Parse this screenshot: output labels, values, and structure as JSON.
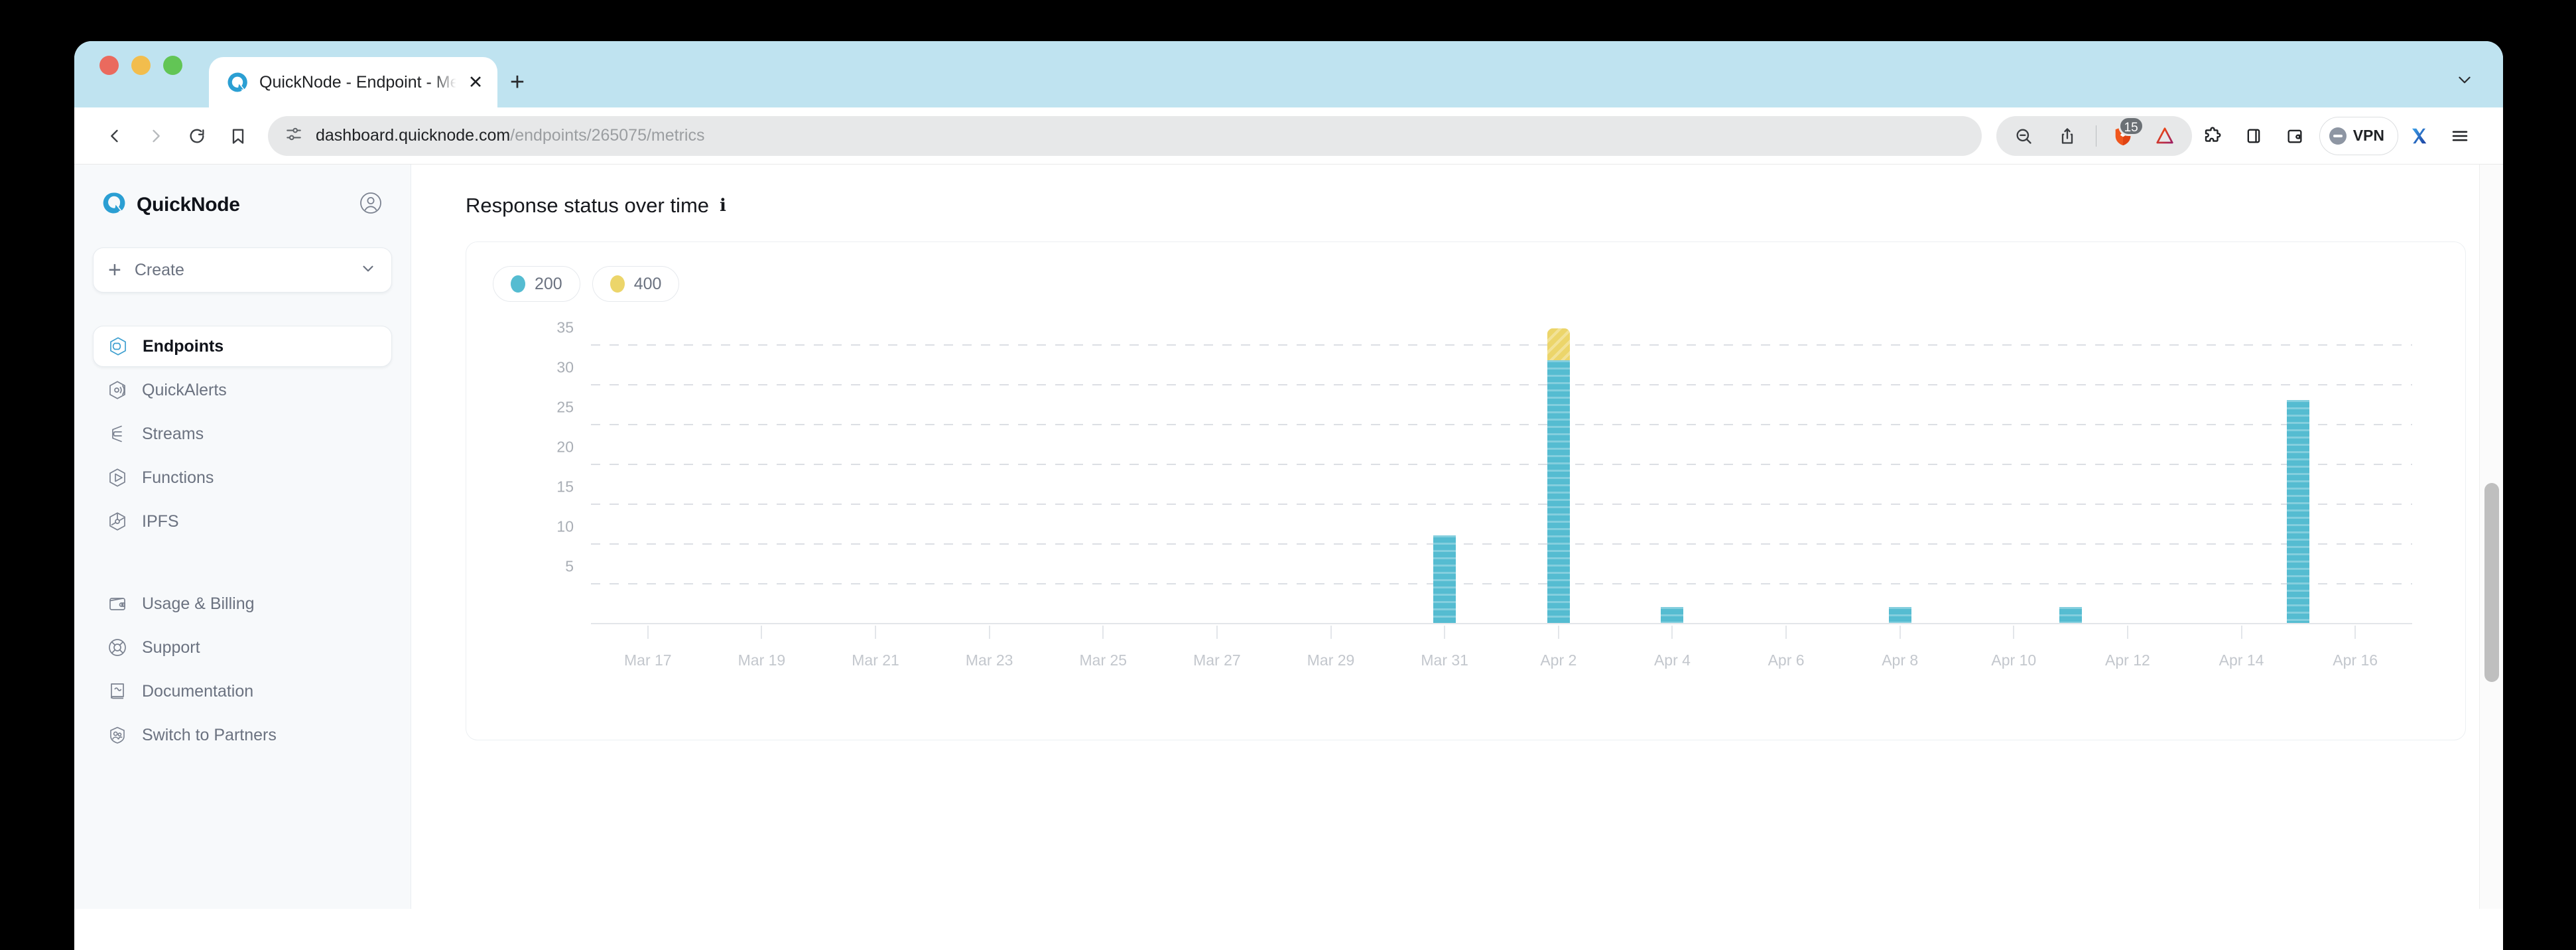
{
  "browser": {
    "tab": {
      "title": "QuickNode - Endpoint - Metrics",
      "favicon_icon": "quicknode-logo-icon",
      "close_icon": "close-icon"
    },
    "new_tab_icon": "plus-icon",
    "tab_list_icon": "chevron-down-icon",
    "nav": {
      "back_icon": "back-arrow-icon",
      "forward_icon": "forward-arrow-icon",
      "reload_icon": "reload-icon",
      "bookmark_icon": "bookmark-icon"
    },
    "omnibox": {
      "site_settings_icon": "tune-sliders-icon",
      "domain": "dashboard.quicknode.com",
      "path": "/endpoints/265075/metrics"
    },
    "actions": [
      {
        "name": "zoom-out-icon",
        "label": ""
      },
      {
        "name": "share-icon",
        "label": ""
      },
      {
        "name": "brave-shield-icon",
        "label": "",
        "badge": "15"
      },
      {
        "name": "brave-rewards-icon",
        "label": ""
      },
      {
        "name": "extensions-icon",
        "label": ""
      },
      {
        "name": "sidebar-panel-icon",
        "label": ""
      },
      {
        "name": "wallet-icon",
        "label": ""
      }
    ],
    "vpn": {
      "label": "VPN",
      "icon": "vpn-toggle-icon"
    },
    "profile_icon": "x-profile-icon",
    "menu_icon": "hamburger-menu-icon"
  },
  "sidebar": {
    "brand": {
      "name": "QuickNode",
      "logo_icon": "quicknode-logo-icon"
    },
    "account_icon": "account-avatar-icon",
    "create": {
      "label": "Create",
      "plus_icon": "plus-icon",
      "chevron_icon": "chevron-down-icon"
    },
    "items": [
      {
        "label": "Endpoints",
        "icon": "endpoints-icon",
        "active": true
      },
      {
        "label": "QuickAlerts",
        "icon": "quickalerts-icon",
        "active": false
      },
      {
        "label": "Streams",
        "icon": "streams-icon",
        "active": false
      },
      {
        "label": "Functions",
        "icon": "functions-icon",
        "active": false
      },
      {
        "label": "IPFS",
        "icon": "ipfs-icon",
        "active": false
      }
    ],
    "footer_items": [
      {
        "label": "Usage & Billing",
        "icon": "wallet-icon"
      },
      {
        "label": "Support",
        "icon": "lifebuoy-icon"
      },
      {
        "label": "Documentation",
        "icon": "book-icon"
      },
      {
        "label": "Switch to Partners",
        "icon": "partners-icon"
      }
    ]
  },
  "main": {
    "section_title": "Response status over time",
    "info_icon": "info-icon"
  },
  "chart_data": {
    "type": "bar",
    "stacked": true,
    "title": "Response status over time",
    "xlabel": "",
    "ylabel": "",
    "grid": true,
    "legend_position": "top-left",
    "ylim": [
      0,
      38
    ],
    "yticks": [
      5,
      10,
      15,
      20,
      25,
      30,
      35
    ],
    "xticks": [
      "Mar 17",
      "Mar 19",
      "Mar 21",
      "Mar 23",
      "Mar 25",
      "Mar 27",
      "Mar 29",
      "Mar 31",
      "Apr 2",
      "Apr 4",
      "Apr 6",
      "Apr 8",
      "Apr 10",
      "Apr 12",
      "Apr 14",
      "Apr 16"
    ],
    "x_start": "Mar 16",
    "x_end": "Apr 17",
    "colors": {
      "200": "#55bcd1",
      "400": "#ecd56a"
    },
    "series": [
      {
        "name": "200",
        "color": "#55bcd1"
      },
      {
        "name": "400",
        "color": "#ecd56a"
      }
    ],
    "points": [
      {
        "x": "Mar 31",
        "v200": 11,
        "v400": 0
      },
      {
        "x": "Apr 2",
        "v200": 33,
        "v400": 4
      },
      {
        "x": "Apr 4",
        "v200": 2,
        "v400": 0
      },
      {
        "x": "Apr 8",
        "v200": 2,
        "v400": 0
      },
      {
        "x": "Apr 11",
        "v200": 2,
        "v400": 0
      },
      {
        "x": "Apr 15",
        "v200": 28,
        "v400": 0
      }
    ]
  },
  "scrollbar": {
    "name": "vertical-scrollbar"
  }
}
